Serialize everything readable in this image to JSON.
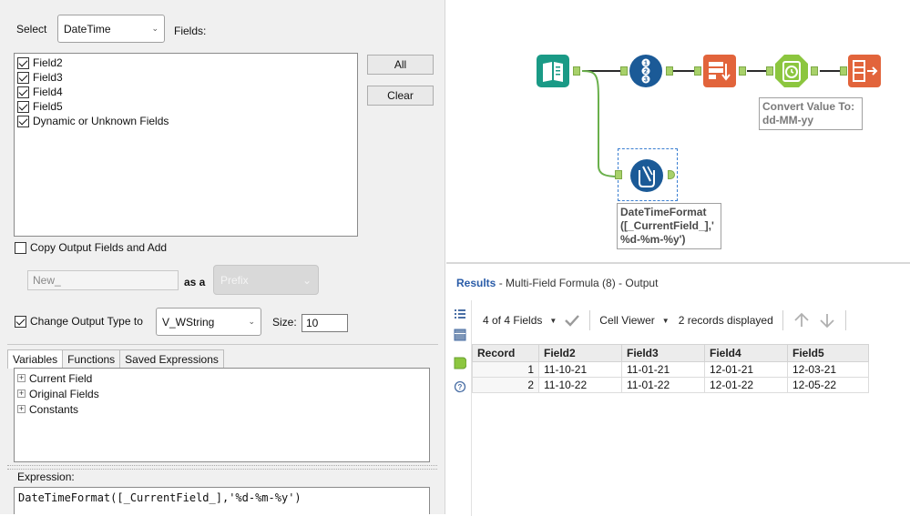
{
  "config": {
    "select_label": "Select",
    "select_value": "DateTime",
    "fields_label": "Fields:",
    "fields": [
      {
        "label": "Field2",
        "checked": true
      },
      {
        "label": "Field3",
        "checked": true
      },
      {
        "label": "Field4",
        "checked": true
      },
      {
        "label": "Field5",
        "checked": true
      },
      {
        "label": "Dynamic or Unknown Fields",
        "checked": true
      }
    ],
    "all_button": "All",
    "clear_button": "Clear",
    "copy_output_label": "Copy Output Fields and Add",
    "copy_output_checked": false,
    "prefix_value": "New_",
    "as_a_label": "as a",
    "prefix_mode": "Prefix",
    "change_type_label": "Change Output Type to",
    "change_type_checked": true,
    "output_type": "V_WString",
    "size_label": "Size:",
    "size_value": "10"
  },
  "variables": {
    "tabs": [
      "Variables",
      "Functions",
      "Saved Expressions"
    ],
    "active_tab": "Variables",
    "tree": [
      "Current Field",
      "Original Fields",
      "Constants"
    ]
  },
  "expression": {
    "label": "Expression:",
    "value": "DateTimeFormat([_CurrentField_],'%d-%m-%y')"
  },
  "canvas": {
    "annotation_convert": [
      "Convert Value To:",
      "dd-MM-yy"
    ],
    "annotation_formula": [
      "DateTimeFormat",
      "([_CurrentField_],'",
      "%d-%m-%y')"
    ],
    "colors": {
      "input_tool": "#1a9a86",
      "record_id_tool": "#1b5a97",
      "transform_tool": "#e2643b",
      "datetime_tool": "#8cc63f",
      "formula_tool": "#1b5a97",
      "connector_green": "#6ab04c"
    }
  },
  "results": {
    "title_bold": "Results",
    "title_rest": " - Multi-Field Formula (8) - Output",
    "fields_count": "4 of 4 Fields",
    "cell_viewer": "Cell Viewer",
    "records_displayed": "2 records displayed",
    "columns": [
      "Record",
      "Field2",
      "Field3",
      "Field4",
      "Field5"
    ],
    "rows": [
      [
        "1",
        "11-10-21",
        "11-01-21",
        "12-01-21",
        "12-03-21"
      ],
      [
        "2",
        "11-10-22",
        "11-01-22",
        "12-01-22",
        "12-05-22"
      ]
    ]
  }
}
